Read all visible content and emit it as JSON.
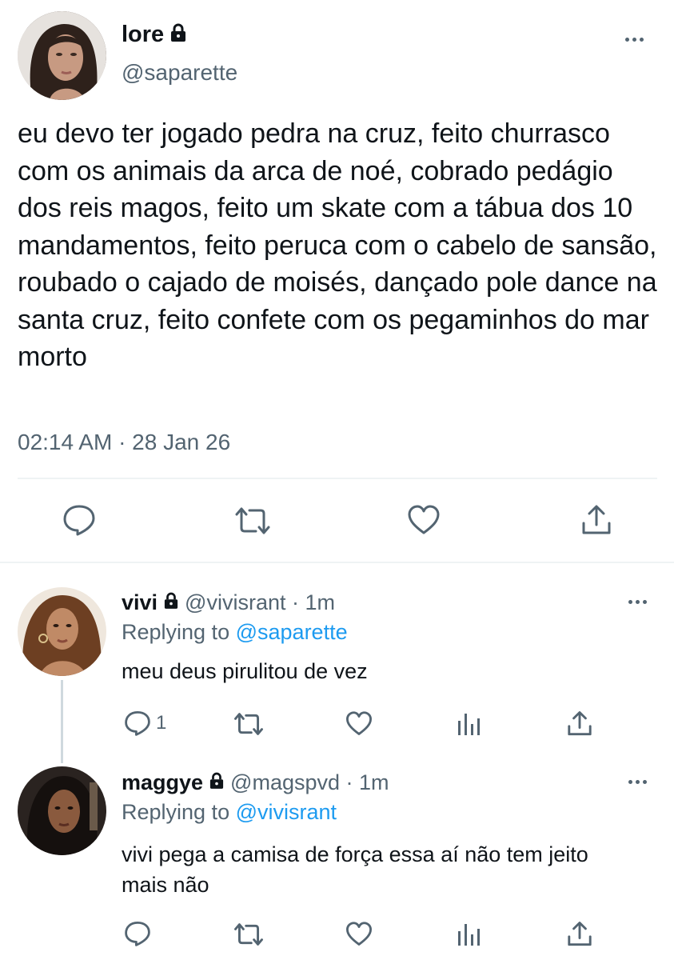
{
  "tweet": {
    "author_name": "lore",
    "author_handle": "@saparette",
    "text": "eu devo ter jogado pedra na cruz, feito churrasco com os animais da arca de noé, cobrado pedágio dos reis magos, feito um skate com a tábua dos 10 mandamentos, feito peruca com o cabelo de sansão, roubado o cajado de moisés, dançado pole dance na santa cruz, feito confete com os pegaminhos do mar morto",
    "timestamp": "02:14 AM · 28 Jan 26",
    "actions": [
      "reply-icon",
      "retweet-icon",
      "like-icon",
      "share-icon"
    ]
  },
  "replies": [
    {
      "author_name": "vivi",
      "author_handle": "@vivisrant · 1m",
      "replying_label": "Replying to",
      "replying_handle": "@saparette",
      "text": "meu deus pirulitou de vez",
      "reply_count": "1"
    },
    {
      "author_name": "maggye",
      "author_handle": "@magspvd · 1m",
      "replying_label": "Replying to",
      "replying_handle": "@vivisrant",
      "text": "vivi pega a camisa de força essa aí não tem jeito mais não",
      "reply_count": ""
    }
  ],
  "colors": {
    "text": "#0f1419",
    "muted": "#536471",
    "link": "#1d9bf0",
    "divider": "#eff3f4"
  }
}
